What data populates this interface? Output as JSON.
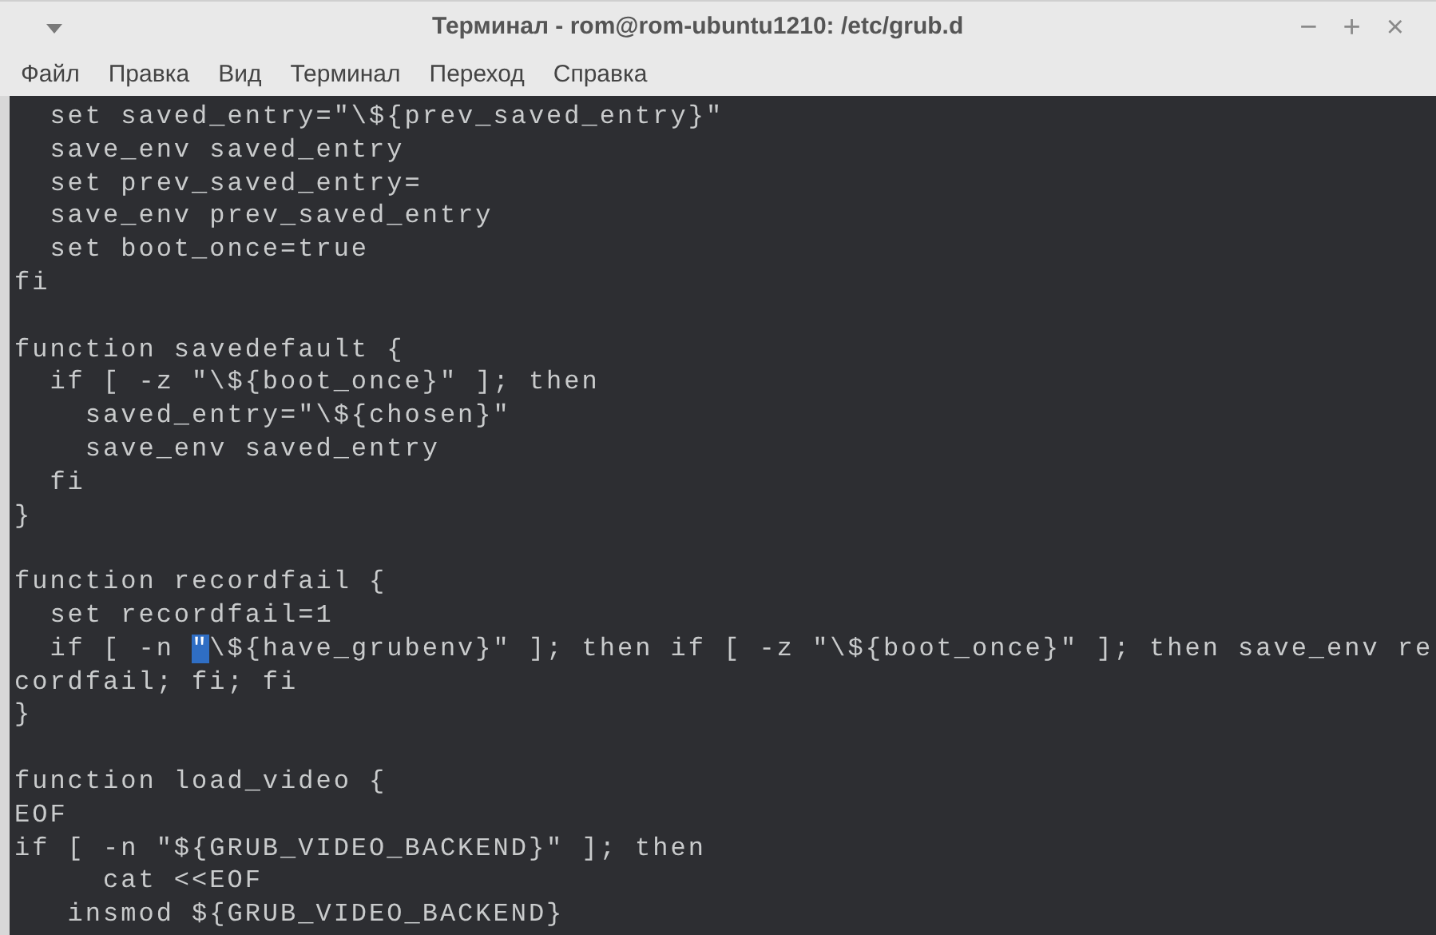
{
  "window": {
    "title": "Терминал - rom@rom-ubuntu1210: /etc/grub.d",
    "controls": [
      "−",
      "+",
      "×"
    ]
  },
  "menu": [
    "Файл",
    "Правка",
    "Вид",
    "Терминал",
    "Переход",
    "Справка"
  ],
  "terminal": {
    "lines": [
      {
        "kind": "text",
        "text": "  set saved_entry=\"\\${prev_saved_entry}\""
      },
      {
        "kind": "text",
        "text": "  save_env saved_entry"
      },
      {
        "kind": "text",
        "text": "  set prev_saved_entry="
      },
      {
        "kind": "text",
        "text": "  save_env prev_saved_entry"
      },
      {
        "kind": "text",
        "text": "  set boot_once=true"
      },
      {
        "kind": "text",
        "text": "fi"
      },
      {
        "kind": "blank"
      },
      {
        "kind": "text",
        "text": "function savedefault {"
      },
      {
        "kind": "text",
        "text": "  if [ -z \"\\${boot_once}\" ]; then"
      },
      {
        "kind": "text",
        "text": "    saved_entry=\"\\${chosen}\""
      },
      {
        "kind": "text",
        "text": "    save_env saved_entry"
      },
      {
        "kind": "text",
        "text": "  fi"
      },
      {
        "kind": "text",
        "text": "}"
      },
      {
        "kind": "blank"
      },
      {
        "kind": "text",
        "text": "function recordfail {"
      },
      {
        "kind": "text",
        "text": "  set recordfail=1"
      },
      {
        "kind": "cursor",
        "before": "  if [ -n ",
        "cursor": "\"",
        "after": "\\${have_grubenv}\" ]; then if [ -z \"\\${boot_once}\" ]; then save_env re"
      },
      {
        "kind": "text",
        "text": "cordfail; fi; fi"
      },
      {
        "kind": "text",
        "text": "}"
      },
      {
        "kind": "blank"
      },
      {
        "kind": "text",
        "text": "function load_video {"
      },
      {
        "kind": "text",
        "text": "EOF"
      },
      {
        "kind": "text",
        "text": "if [ -n \"${GRUB_VIDEO_BACKEND}\" ]; then"
      },
      {
        "kind": "text",
        "text": "     cat <<EOF"
      },
      {
        "kind": "text",
        "text": "   insmod ${GRUB_VIDEO_BACKEND}"
      }
    ]
  }
}
